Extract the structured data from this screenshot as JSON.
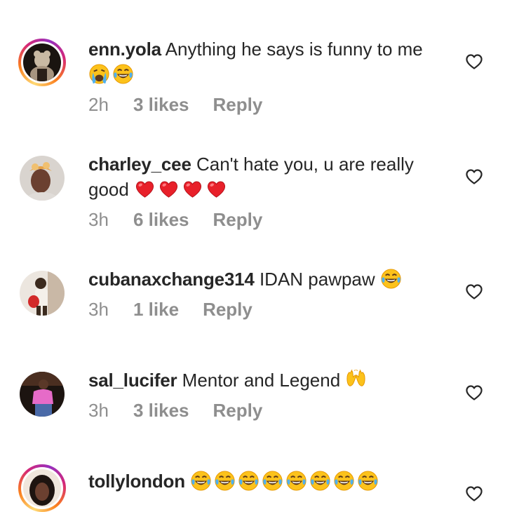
{
  "comments": [
    {
      "username": "enn.yola",
      "text": "Anything he says is funny to me",
      "emojis": [
        "crying-face",
        "joy-face"
      ],
      "time": "2h",
      "likes": "3 likes",
      "reply_label": "Reply",
      "story_ring": true
    },
    {
      "username": "charley_cee",
      "text": "Can't hate you, u are really good",
      "emojis": [
        "heart",
        "heart",
        "heart",
        "heart"
      ],
      "time": "3h",
      "likes": "6 likes",
      "reply_label": "Reply",
      "story_ring": false
    },
    {
      "username": "cubanaxchange314",
      "text": "IDAN pawpaw",
      "emojis": [
        "joy-face"
      ],
      "time": "3h",
      "likes": "1 like",
      "reply_label": "Reply",
      "story_ring": false
    },
    {
      "username": "sal_lucifer",
      "text": "Mentor and Legend",
      "emojis": [
        "raising-hands"
      ],
      "time": "3h",
      "likes": "3 likes",
      "reply_label": "Reply",
      "story_ring": false
    },
    {
      "username": "tollylondon",
      "text": "",
      "emojis": [
        "joy-face",
        "joy-face",
        "joy-face",
        "joy-face",
        "joy-face",
        "joy-face",
        "joy-face",
        "joy-face"
      ],
      "story_ring": true
    }
  ],
  "colors": {
    "text": "#262626",
    "secondary": "#8e8e8e",
    "heart_red": "#e8202a",
    "emoji_yellow": "#fcc21b"
  }
}
